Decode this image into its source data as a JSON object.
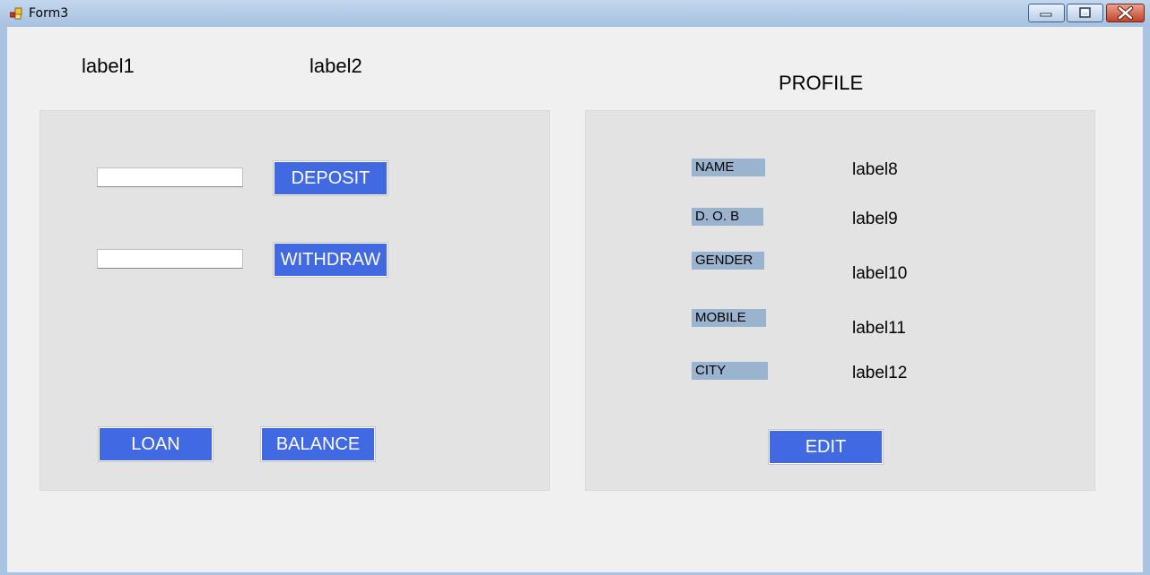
{
  "window": {
    "title": "Form3"
  },
  "header": {
    "label1": "label1",
    "label2": "label2",
    "profile_title": "PROFILE"
  },
  "account": {
    "deposit_amount": "",
    "withdraw_amount": "",
    "deposit_button": "DEPOSIT",
    "withdraw_button": "WITHDRAW",
    "loan_button": "LOAN",
    "balance_button": "BALANCE"
  },
  "profile": {
    "fields": [
      {
        "label": "NAME",
        "value": "label8"
      },
      {
        "label": "D. O. B",
        "value": "label9"
      },
      {
        "label": "GENDER",
        "value": "label10"
      },
      {
        "label": "MOBILE",
        "value": "label11"
      },
      {
        "label": "CITY",
        "value": "label12"
      }
    ],
    "edit_button": "EDIT"
  },
  "colors": {
    "button": "#4169e1",
    "field_label_bg": "#9ab3cf",
    "panel": "#e3e3e3",
    "client": "#f0f0f0"
  }
}
